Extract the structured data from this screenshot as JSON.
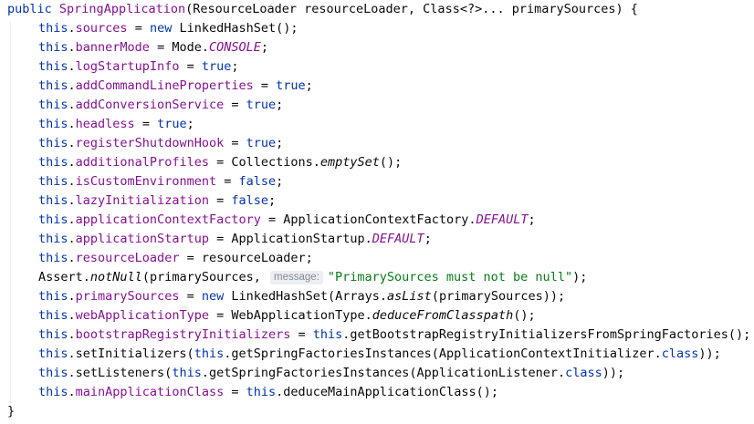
{
  "code": {
    "signature": {
      "kw_public": "public",
      "name": "SpringApplication",
      "params": "(ResourceLoader resourceLoader, Class<?>... primarySources) {"
    },
    "lines": {
      "l2": {
        "this": "this",
        "field": "sources",
        "eq": " = ",
        "kw_new": "new",
        "rest": " LinkedHashSet();"
      },
      "l3": {
        "this": "this",
        "field": "bannerMode",
        "eq": " = Mode.",
        "const": "CONSOLE",
        "rest": ";"
      },
      "l4": {
        "this": "this",
        "field": "logStartupInfo",
        "eq": " = ",
        "kw": "true",
        "rest": ";"
      },
      "l5": {
        "this": "this",
        "field": "addCommandLineProperties",
        "eq": " = ",
        "kw": "true",
        "rest": ";"
      },
      "l6": {
        "this": "this",
        "field": "addConversionService",
        "eq": " = ",
        "kw": "true",
        "rest": ";"
      },
      "l7": {
        "this": "this",
        "field": "headless",
        "eq": " = ",
        "kw": "true",
        "rest": ";"
      },
      "l8": {
        "this": "this",
        "field": "registerShutdownHook",
        "eq": " = ",
        "kw": "true",
        "rest": ";"
      },
      "l9": {
        "this": "this",
        "field": "additionalProfiles",
        "eq": " = Collections.",
        "method": "emptySet",
        "rest": "();"
      },
      "l10": {
        "this": "this",
        "field": "isCustomEnvironment",
        "eq": " = ",
        "kw": "false",
        "rest": ";"
      },
      "l11": {
        "this": "this",
        "field": "lazyInitialization",
        "eq": " = ",
        "kw": "false",
        "rest": ";"
      },
      "l12": {
        "this": "this",
        "field": "applicationContextFactory",
        "eq": " = ApplicationContextFactory.",
        "const": "DEFAULT",
        "rest": ";"
      },
      "l13": {
        "this": "this",
        "field": "applicationStartup",
        "eq": " = ApplicationStartup.",
        "const": "DEFAULT",
        "rest": ";"
      },
      "l14": {
        "this": "this",
        "field": "resourceLoader",
        "eq": " = resourceLoader;"
      },
      "l15": {
        "pre": "Assert.",
        "method": "notNull",
        "args": "(primarySources,",
        "hint": "message:",
        "str": "\"PrimarySources must not be null\"",
        "rest": ");"
      },
      "l16": {
        "this": "this",
        "field": "primarySources",
        "eq": " = ",
        "kw_new": "new",
        "mid": " LinkedHashSet(Arrays.",
        "method": "asList",
        "rest": "(primarySources));"
      },
      "l17": {
        "this": "this",
        "field": "webApplicationType",
        "eq": " = WebApplicationType.",
        "method": "deduceFromClasspath",
        "rest": "();"
      },
      "l18": {
        "this": "this",
        "field": "bootstrapRegistryInitializers",
        "eq": " = ",
        "this2": "this",
        "rest": ".getBootstrapRegistryInitializersFromSpringFactories();"
      },
      "l19": {
        "this": "this",
        "mid": ".setInitializers(",
        "this2": "this",
        "mid2": ".getSpringFactoriesInstances(ApplicationContextInitializer.",
        "kw": "class",
        "rest": "));"
      },
      "l20": {
        "this": "this",
        "mid": ".setListeners(",
        "this2": "this",
        "mid2": ".getSpringFactoriesInstances(ApplicationListener.",
        "kw": "class",
        "rest": "));"
      },
      "l21": {
        "this": "this",
        "field": "mainApplicationClass",
        "eq": " = ",
        "this2": "this",
        "rest": ".deduceMainApplicationClass();"
      }
    },
    "closing_brace": "}"
  }
}
